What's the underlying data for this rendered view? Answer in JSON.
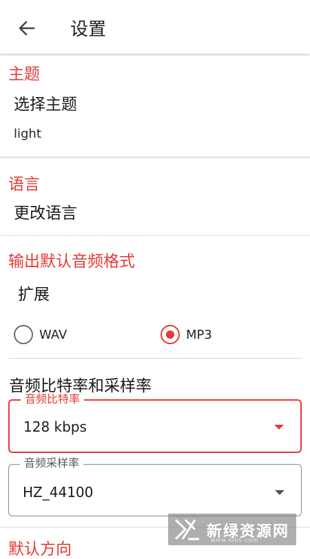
{
  "appbar": {
    "title": "设置",
    "back_icon": "arrow-back-icon"
  },
  "theme": {
    "section_title": "主题",
    "select_label": "选择主题",
    "current_value": "light"
  },
  "language": {
    "section_title": "语言",
    "change_label": "更改语言"
  },
  "output_format": {
    "section_title": "输出默认音频格式",
    "extension_label": "扩展",
    "options": [
      {
        "label": "WAV",
        "checked": false
      },
      {
        "label": "MP3",
        "checked": true
      }
    ]
  },
  "bitrate_samplerate": {
    "heading": "音频比特率和采样率",
    "bitrate": {
      "label": "音频比特率",
      "value": "128 kbps"
    },
    "samplerate": {
      "label": "音频采样率",
      "value": "HZ_44100"
    }
  },
  "default_direction": {
    "section_title": "默认方向"
  },
  "watermark": {
    "text": "新绿资源网",
    "url": "www.xlhs.com"
  },
  "colors": {
    "accent": "#e53935",
    "divider": "#e6e6e6"
  }
}
